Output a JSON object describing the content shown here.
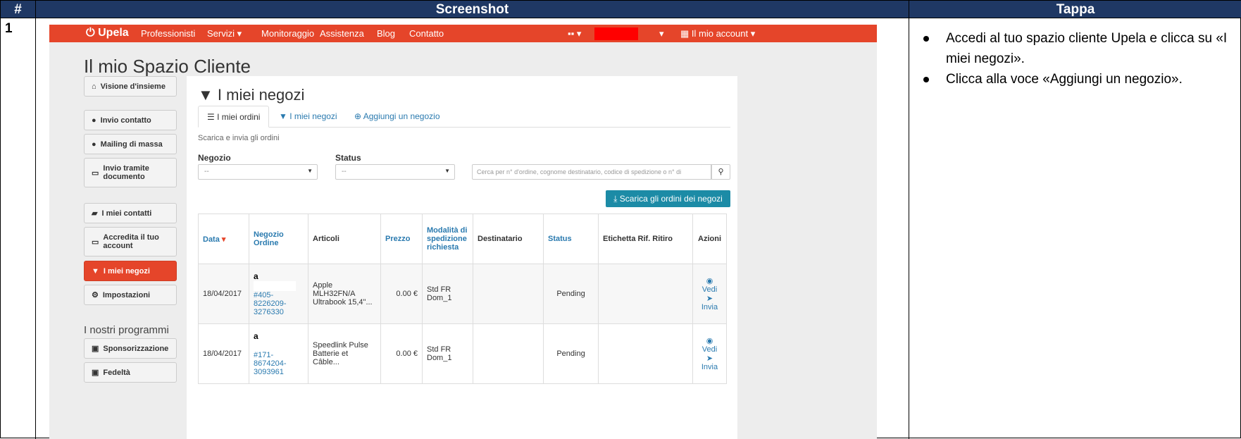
{
  "headers": {
    "num": "#",
    "screenshot": "Screenshot",
    "step": "Tappa"
  },
  "row": {
    "num": "1"
  },
  "steps": [
    "Accedi al tuo spazio cliente Upela e clicca su «I miei negozi».",
    "Clicca alla voce «Aggiungi un negozio»."
  ],
  "nav": {
    "logo": "Upela",
    "items": [
      "Professionisti",
      "Servizi ▾",
      "Monitoraggio",
      "Assistenza",
      "Blog",
      "Contatto"
    ],
    "flag": "▪▪ ▾",
    "account": "Il mio account ▾"
  },
  "page_title": "Il mio Spazio Cliente",
  "sidebar": {
    "items": [
      {
        "icon": "⌂",
        "label": "Visione d'insieme"
      },
      {
        "icon": "●",
        "label": "Invio contatto"
      },
      {
        "icon": "●",
        "label": "Mailing di massa"
      },
      {
        "icon": "▭",
        "label": "Invio tramite documento"
      },
      {
        "icon": "▰",
        "label": "I miei contatti"
      },
      {
        "icon": "▭",
        "label": "Accredita il tuo account"
      },
      {
        "icon": "▼",
        "label": "I miei negozi"
      },
      {
        "icon": "⚙",
        "label": "Impostazioni"
      }
    ],
    "programs_title": "I nostri programmi",
    "programs": [
      {
        "icon": "▣",
        "label": "Sponsorizzazione"
      },
      {
        "icon": "▣",
        "label": "Fedeltà"
      }
    ]
  },
  "panel": {
    "title": "I miei negozi",
    "tabs": [
      "I miei ordini",
      "I miei negozi",
      "Aggiungi un negozio"
    ],
    "subtitle": "Scarica e invia gli ordini",
    "filter_shop_label": "Negozio",
    "filter_status_label": "Status",
    "select_placeholder": "--",
    "search_placeholder": "Cerca per n° d'ordine, cognome destinatario, codice di spedizione o n° di",
    "download_button": "Scarica gli ordini dei negozi"
  },
  "table": {
    "columns": [
      "Data",
      "Negozio Ordine",
      "Articoli",
      "Prezzo",
      "Modalità di spedizione richiesta",
      "Destinatario",
      "Status",
      "Etichetta Rif. Ritiro",
      "Azioni"
    ],
    "rows": [
      {
        "date": "18/04/2017",
        "shop": "a",
        "order": "#405-8226209-3276330",
        "article": "Apple MLH32FN/A Ultrabook 15,4\"...",
        "price": "0.00 €",
        "shipping": "Std FR Dom_1",
        "recipient": "",
        "status": "Pending",
        "label": "",
        "view": "Vedi",
        "send": "Invia"
      },
      {
        "date": "18/04/2017",
        "shop": "a",
        "order": "#171-8674204-3093961",
        "article": "Speedlink Pulse Batterie et Câble...",
        "price": "0.00 €",
        "shipping": "Std FR Dom_1",
        "recipient": "",
        "status": "Pending",
        "label": "",
        "view": "Vedi",
        "send": "Invia"
      }
    ]
  },
  "colors": {
    "header_bg": "#1f3864",
    "nav_bg": "#e5452a",
    "accent": "#1c8ba6",
    "link": "#2a7aaf"
  }
}
